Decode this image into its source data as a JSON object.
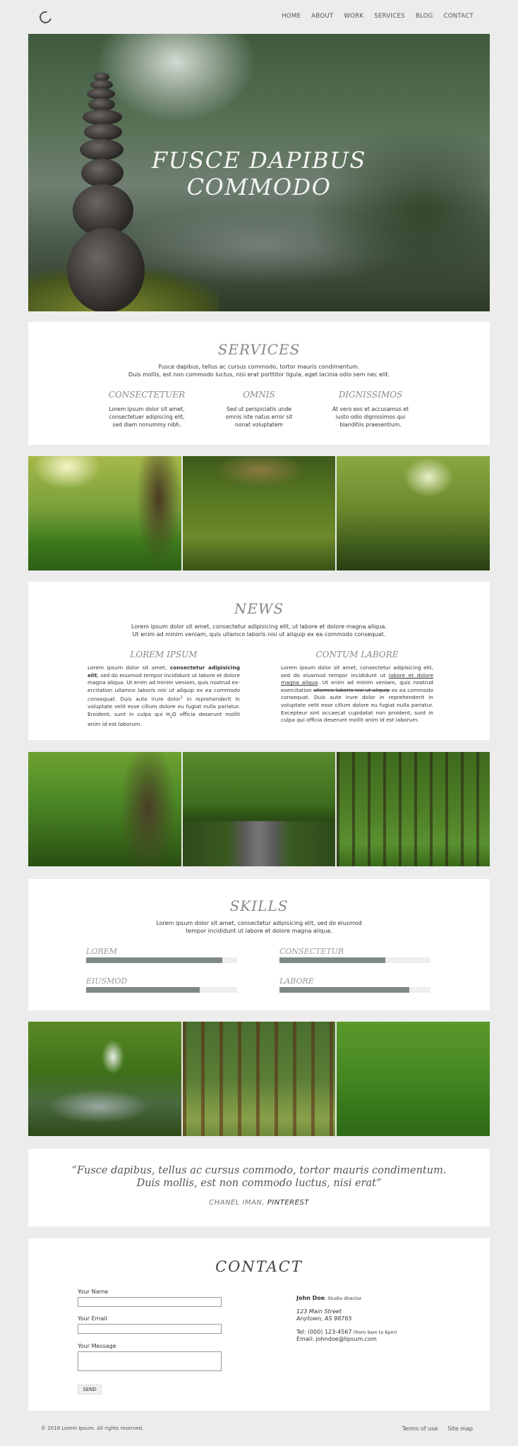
{
  "nav": {
    "items": [
      "HOME",
      "ABOUT",
      "WORK",
      "SERVICES",
      "BLOG",
      "CONTACT"
    ]
  },
  "hero": {
    "title_line1": "FUSCE DAPIBUS",
    "title_line2": "COMMODO"
  },
  "services": {
    "title": "SERVICES",
    "intro_line1": "Fusce dapibus, tellus ac cursus commodo, tortor mauris condimentum.",
    "intro_line2": "Duis mollis, est non commodo luctus, nisi erat porttitor ligula, eget lacinia odio sem nec elit.",
    "columns": [
      {
        "title": "CONSECTETUER",
        "lines": [
          "Lorem ipsum dolor sit amet,",
          "consectetuer adipiscing elit,",
          "sed diam nonummy nibh."
        ]
      },
      {
        "title": "OMNIS",
        "lines": [
          "Sed ut perspiciatis unde",
          "omnis iste natus error sit",
          "nonat voluptatem"
        ]
      },
      {
        "title": "DIGNISSIMOS",
        "lines": [
          "At vero eos et accusamus et",
          "iusto odio dignissimos qui",
          "blanditiis praesentium."
        ]
      }
    ]
  },
  "news": {
    "title": "NEWS",
    "intro_line1": "Lorem ipsum dolor sit amet, consectetur adipisicing elit, ut labore et dolore magna aliqua.",
    "intro_line2": "Ut enim ad minim veniam, quis ullamco laboris nisi ut aliquip ex ea commodo consequat.",
    "left": {
      "title": "LOREM IPSUM",
      "p1": "Lorem ipsum dolor sit amet, ",
      "p1_bold": "consectetur adipisicing elit",
      "p2": ", sed do eiusmod tempor incididunt ut labore et dolore magna aliqua. Ut enim ad minim veniam, quis nostrud ex-",
      "p3_italic": "ercitation ullamco laboris nisi ut aliquip ex ea commodo consequat",
      "p4": ". Duis aute irure dolor",
      "p4_sup": "1",
      "p5": " in reprehenderit in voluptate velit esse cillum dolore eu fugiat nulla pariatur. Eroident, sunt in culpa qui H",
      "p5_sub": "2",
      "p6": "O officia deserunt mollit anim id est laborum."
    },
    "right": {
      "title": "CONTUM LABORE",
      "p1": "Lorem ipsum dolor sit amet, consectetur adipisicing elit, sed do eiusmod tempor incididunt ut ",
      "p1_underline": "labore et dolore magna aliqua",
      "p2": ". Ut enim ad minim veniam, quis nostrud exercitation ",
      "p2_strike": "ullamco laboris nisi ut aliquip",
      "p3": " ex ea commodo consequat. Duis aute irure dolor in reprehenderit in voluptate velit esse cillum dolore eu fugiat nulla pariatur. Excepteur sint occaecat cupidatat non proident, sunt in culpa qui officia deserunt mollit anim id est laborum."
    }
  },
  "skills": {
    "title": "SKILLS",
    "intro_line1": "Lorem ipsum dolor sit amet, consectetur adipisicing elit, sed do eiusmod",
    "intro_line2": "tempor incididunt ut labore et dolore magna aliqua.",
    "items": [
      {
        "label": "LOREM",
        "percent": 90
      },
      {
        "label": "CONSECTETUR",
        "percent": 70
      },
      {
        "label": "EIUSMOD",
        "percent": 75
      },
      {
        "label": "LABORE",
        "percent": 86
      }
    ]
  },
  "quote": {
    "line1": "“Fusce dapibus, tellus ac cursus commodo, tortor mauris condimentum.",
    "line2": "Duis mollis, est non commodo luctus, nisi erat”",
    "author": "CHANEL IMAN, ",
    "source": "PINTEREST"
  },
  "contact": {
    "title": "CONTACT",
    "name_label": "Your Name",
    "email_label": "Your Email",
    "message_label": "Your Message",
    "send_label": "SEND",
    "person_name": "John Doe",
    "person_role": ", Studio director",
    "address1": "123 Main Street",
    "address2": "Anytown, AS 98765",
    "tel": "Tel: (000) 123-4567",
    "tel_hours": " (from 9am to 6pm)",
    "email": "Email: johndoe@lipsum.com"
  },
  "footer": {
    "copyright": "© 2018 Lorem Ipsum. All rights reserved.",
    "terms": "Terms of use",
    "sitemap": "Site map"
  },
  "colors": {
    "background": "#ececec",
    "panel": "#ffffff",
    "heading": "#888888",
    "skill_bar": "#7f8883"
  }
}
